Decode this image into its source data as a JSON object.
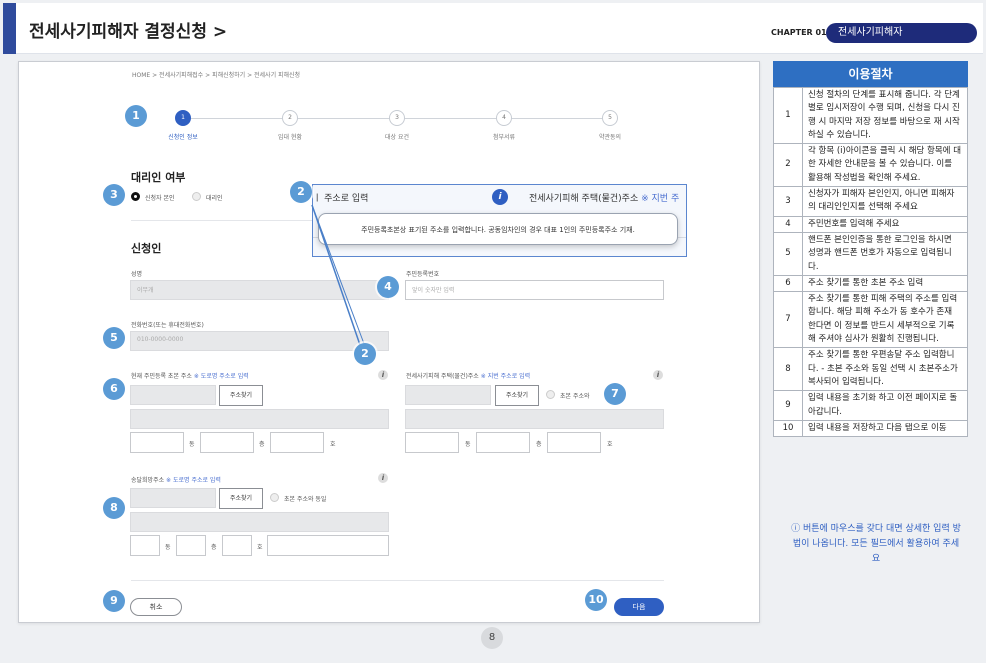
{
  "header": {
    "title": "전세사기피해자 결정신청 >",
    "chapter": "CHAPTER 01",
    "chapter_name": "전세사기피해자"
  },
  "breadcrumb": "HOME > 전세사기피해접수 > 피해신청하기 > 전세사기 피해신청",
  "steps": [
    {
      "num": "1",
      "label": "신청인 정보"
    },
    {
      "num": "2",
      "label": "임대 현황"
    },
    {
      "num": "3",
      "label": "대상 요건"
    },
    {
      "num": "4",
      "label": "첨부서류"
    },
    {
      "num": "5",
      "label": "약관동의"
    }
  ],
  "agent": {
    "title": "대리인 여부",
    "opt_self": "신청자 본인",
    "opt_agent": "대리인"
  },
  "applicant": {
    "title": "신청인",
    "name_label": "성명",
    "name_value": "이무개",
    "rrn_label": "주민등록번호",
    "rrn_placeholder": "앞이 숫자만 입력",
    "phone_label": "전화번호(또는 휴대전화번호)",
    "phone_placeholder": "010-0000-0000"
  },
  "address": {
    "current_label": "현재 주민등록 초본 주소",
    "current_link": "※ 도로명 주소로 입력",
    "victim_label": "전세사기피해 주택(물건)주소",
    "victim_link": "※ 지번 주소로 입력",
    "delivery_label": "송달희망주소",
    "delivery_link": "※ 도로명 주소로 입력",
    "find_button": "주소찾기",
    "same_as_current": "초본 주소와 동일",
    "same_short": "초본 주소와",
    "unit_dong": "동",
    "unit_floor": "층",
    "unit_ho": "호"
  },
  "tooltip": {
    "field_label": "주소로 입력",
    "prefix": "ㅣ",
    "right_label": "전세사기피해 주택(물건)주소",
    "right_link": "※ 지번 주",
    "text": "주민등록초본상 표기된 주소를 입력합니다. 공동임차인의 경우 대표 1인의 주민등록주소 기재."
  },
  "buttons": {
    "cancel": "취소",
    "next": "다음"
  },
  "markers": {
    "m1": "1",
    "m2": "2",
    "m3": "3",
    "m4": "4",
    "m5": "5",
    "m6": "6",
    "m7": "7",
    "m8": "8",
    "m9": "9",
    "m10": "10"
  },
  "info_icon": "i",
  "panel": {
    "title": "이용절차",
    "rows": [
      {
        "n": "1",
        "text": "신청 절차의 단계를 표시해 줍니다. 각 단계 별로 임시저장이 수행 되며, 신청을 다시 진행 시 마지막 저장 정보를 바탕으로 재 시작 하실 수 있습니다."
      },
      {
        "n": "2",
        "text": "각 항목 (i)아이콘을 클릭 시 해당 항목에 대한 자세한 안내문을 볼 수 있습니다. 이를 활용해 작성법을 확인해 주세요."
      },
      {
        "n": "3",
        "text": "신청자가 피해자 본인인지, 아니면 피해자의 대리인인지를 선택해 주세요"
      },
      {
        "n": "4",
        "text": "주민번호를 입력해 주세요"
      },
      {
        "n": "5",
        "text": "핸드폰 본인인증을 통한 로그인을 하시면 성명과 핸드폰 번호가 자동으로 입력됩니다."
      },
      {
        "n": "6",
        "text": "주소 찾기를 통한 초본 주소 입력"
      },
      {
        "n": "7",
        "text": "주소 찾기를 통한 피해 주택의 주소를 입력합니다. 해당 피해 주소가 동 호수가 존재 한다면 이 정보를 반드시 세부적으로 기록해 주셔야 심사가 원활히 진행됩니다."
      },
      {
        "n": "8",
        "text": "주소 찾기를 통한 우편송달 주소 입력합니다. -   초본 주소와 동일 선택 시 초본주소가 복사되어 입력됩니다."
      },
      {
        "n": "9",
        "text": "입력 내용을 초기화 하고 이전 페이지로 돌아갑니다."
      },
      {
        "n": "10",
        "text": "입력 내용을 저장하고 다음 탭으로 이동"
      }
    ],
    "note": "ⓘ 버튼에 마우스를 갖다 대면 상세한 입력 방법이 나옵니다. 모든 필드에서 활용하여 주세요"
  },
  "page_number": "8",
  "colors": {
    "accent": "#2f5fc2",
    "marker": "#5b9bd5",
    "header_pill": "#1e2b7a",
    "panel_head": "#2e6fc2"
  }
}
